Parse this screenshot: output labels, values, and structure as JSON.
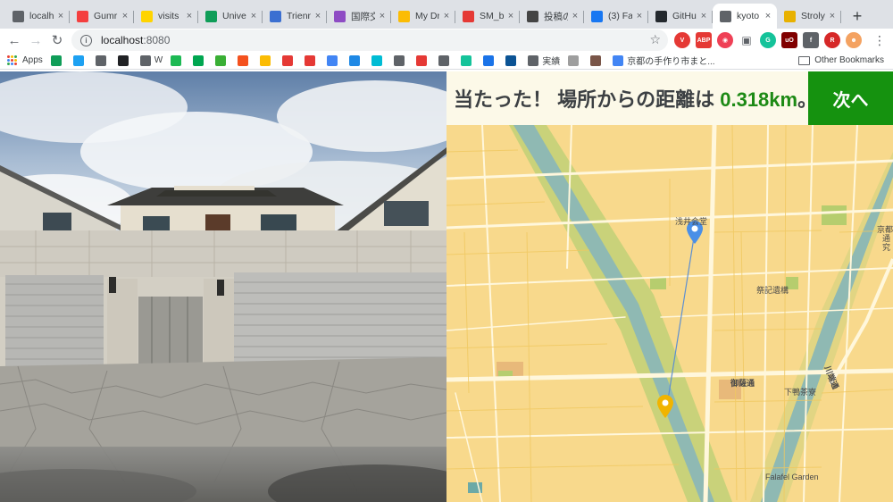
{
  "browser": {
    "tabs": [
      {
        "title": "localh",
        "icon": "globe-icon",
        "color": "#5f6368"
      },
      {
        "title": "Gumr",
        "icon": "gumroad-icon",
        "color": "#f43f3f"
      },
      {
        "title": "visits",
        "icon": "chat-icon",
        "color": "#ffd400"
      },
      {
        "title": "Univer",
        "icon": "sheet-icon",
        "color": "#0f9d58"
      },
      {
        "title": "Trienn",
        "icon": "circle-icon",
        "color": "#3b6fd1"
      },
      {
        "title": "国際交",
        "icon": "shield-icon",
        "color": "#8e4cc4"
      },
      {
        "title": "My Dr",
        "icon": "drive-icon",
        "color": "#fbbc04"
      },
      {
        "title": "SM_b",
        "icon": "pdf-icon",
        "color": "#e53935"
      },
      {
        "title": "投稿の",
        "icon": "wordpress-icon",
        "color": "#444444"
      },
      {
        "title": "(3) Fa",
        "icon": "facebook-icon",
        "color": "#1877f2"
      },
      {
        "title": "GitHu",
        "icon": "github-icon",
        "color": "#24292e"
      },
      {
        "title": "kyoto",
        "icon": "globe-icon",
        "color": "#5f6368",
        "active": true
      },
      {
        "title": "Stroly",
        "icon": "stroly-icon",
        "color": "#e8b100"
      }
    ],
    "url_host": "localhost",
    "url_port": ":8080",
    "bookmarks": [
      {
        "label": "Apps"
      },
      {
        "label": ""
      },
      {
        "label": ""
      },
      {
        "label": ""
      },
      {
        "label": ""
      },
      {
        "label": "W"
      },
      {
        "label": ""
      },
      {
        "label": ""
      },
      {
        "label": ""
      },
      {
        "label": ""
      },
      {
        "label": ""
      },
      {
        "label": ""
      },
      {
        "label": ""
      },
      {
        "label": ""
      },
      {
        "label": ""
      },
      {
        "label": ""
      },
      {
        "label": ""
      },
      {
        "label": ""
      },
      {
        "label": ""
      },
      {
        "label": ""
      },
      {
        "label": ""
      },
      {
        "label": ""
      },
      {
        "label": "実績"
      },
      {
        "label": ""
      },
      {
        "label": ""
      },
      {
        "label": "京都の手作り市まと..."
      }
    ],
    "other_bookmarks": "Other Bookmarks"
  },
  "game": {
    "result_prefix": "当たった！ 場所からの距離は ",
    "distance": "0.318km",
    "result_suffix": "。",
    "next_label": "次へ"
  },
  "map": {
    "labels": {
      "asai_kaido": "浅井会堂",
      "saiki": "祭記遺構",
      "gokoudori": "御薩通",
      "shimogamo": "下鴨茶寮",
      "kawabata": "川端通",
      "kyoto_right": "京都",
      "tsu": "通",
      "ku": "究",
      "falafel": "Falafel Garden"
    }
  },
  "colors": {
    "accent_green": "#15920f",
    "distance_green": "#1d8a15",
    "marker_blue": "#4a8fe7",
    "marker_yellow": "#f1b400"
  }
}
